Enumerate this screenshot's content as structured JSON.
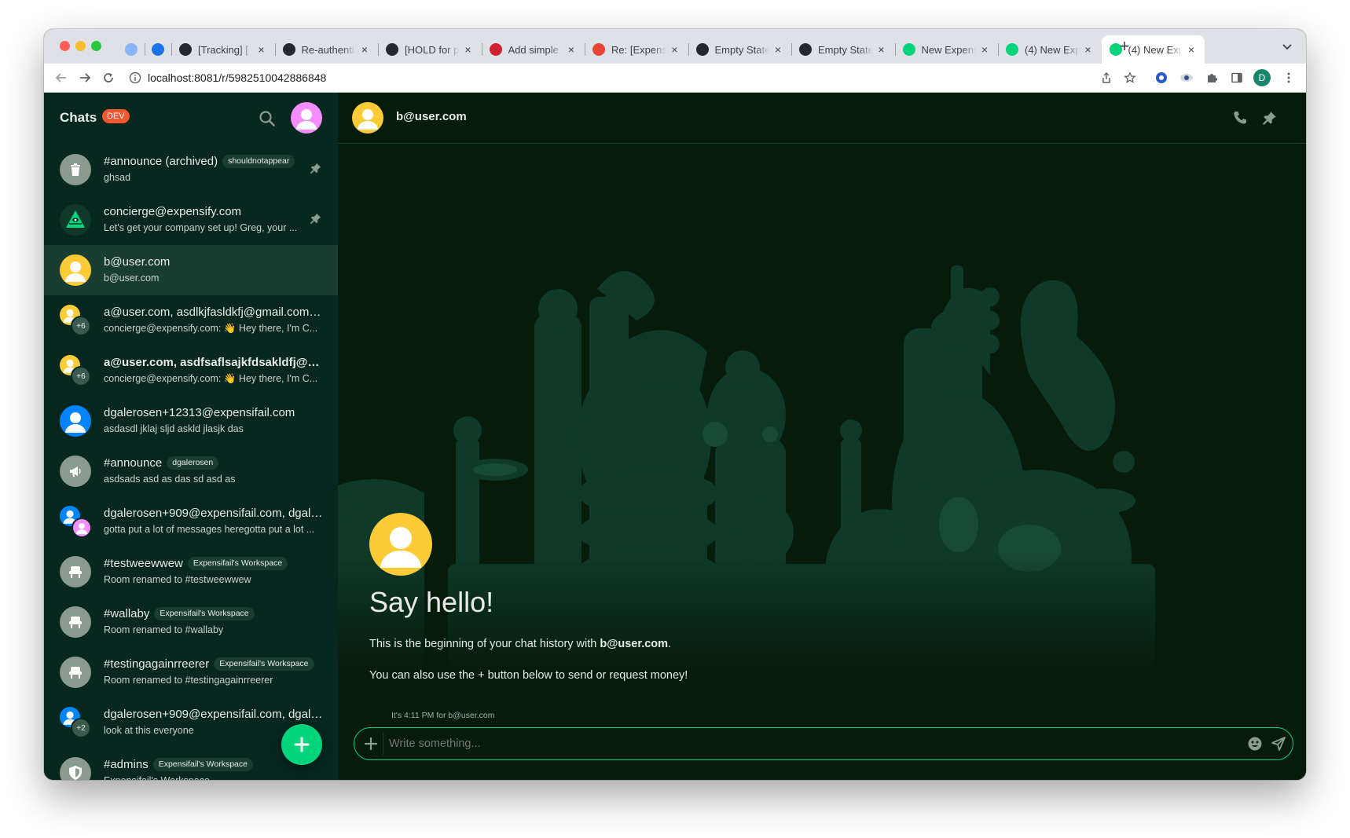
{
  "browser": {
    "tabs": [
      {
        "label": "",
        "icon": "chrome-icon",
        "color": "#8ab4f8"
      },
      {
        "label": "",
        "icon": "calendar-icon",
        "color": "#1a73e8"
      },
      {
        "label": "[Tracking] [",
        "icon": "github-icon",
        "color": "#24292f"
      },
      {
        "label": "Re-authenti",
        "icon": "github-icon",
        "color": "#24292f"
      },
      {
        "label": "[HOLD for p",
        "icon": "github-icon",
        "color": "#24292f"
      },
      {
        "label": "Add simple",
        "icon": "github-pr-icon",
        "color": "#cf222e"
      },
      {
        "label": "Re: [Expens",
        "icon": "gmail-icon",
        "color": "#ea4335"
      },
      {
        "label": "Empty State",
        "icon": "github-icon",
        "color": "#24292f"
      },
      {
        "label": "Empty State",
        "icon": "github-icon",
        "color": "#24292f"
      },
      {
        "label": "New Expens",
        "icon": "expensify-icon",
        "color": "#03d47c"
      },
      {
        "label": "(4) New Exp",
        "icon": "expensify-icon",
        "color": "#03d47c"
      },
      {
        "label": "(4) New Exp",
        "icon": "expensify-icon",
        "color": "#03d47c"
      }
    ],
    "new_tab": "+",
    "url": "localhost:8081/r/5982510042886848",
    "profile_initial": "D"
  },
  "sidebar": {
    "title": "Chats",
    "badge": "DEV",
    "items": [
      {
        "name": "#announce (archived)",
        "pill": "shouldnotappear",
        "preview": "ghsad",
        "avatar": "trash",
        "pinned": true,
        "bold": false,
        "selected": false
      },
      {
        "name": "concierge@expensify.com",
        "pill": "",
        "preview": "Let's get your company set up! Greg, your ...",
        "avatar": "concierge",
        "pinned": true,
        "bold": false,
        "selected": false
      },
      {
        "name": "b@user.com",
        "pill": "",
        "preview": "b@user.com",
        "avatar": "user-yellow",
        "pinned": false,
        "bold": false,
        "selected": true
      },
      {
        "name": "a@user.com, asdlkjfasldkfj@gmail.com, ...",
        "pill": "",
        "preview": "concierge@expensify.com: 👋 Hey there, I'm C...",
        "avatar": "multi",
        "count": "+6",
        "pinned": false,
        "bold": false,
        "selected": false
      },
      {
        "name": "a@user.com, asdfsaflsajkfdsakldfj@gm...",
        "pill": "",
        "preview": "concierge@expensify.com: 👋 Hey there, I'm C...",
        "avatar": "multi",
        "count": "+6",
        "pinned": false,
        "bold": true,
        "selected": false
      },
      {
        "name": "dgalerosen+12313@expensifail.com",
        "pill": "",
        "preview": "asdasdl jklaj sljd askld jlasjk das",
        "avatar": "user-blue",
        "pinned": false,
        "bold": false,
        "selected": false
      },
      {
        "name": "#announce",
        "pill": "dgalerosen",
        "preview": "asdsads asd as das sd asd as",
        "avatar": "megaphone",
        "pinned": false,
        "bold": false,
        "selected": false
      },
      {
        "name": "dgalerosen+909@expensifail.com, dgale...",
        "pill": "",
        "preview": "gotta put a lot of messages heregotta put a lot ...",
        "avatar": "pair",
        "pinned": false,
        "bold": false,
        "selected": false
      },
      {
        "name": "#testweewwew",
        "pill": "Expensifail's Workspace",
        "preview": "Room renamed to #testweewwew",
        "avatar": "chair",
        "pinned": false,
        "bold": false,
        "selected": false
      },
      {
        "name": "#wallaby",
        "pill": "Expensifail's Workspace",
        "preview": "Room renamed to #wallaby",
        "avatar": "chair",
        "pinned": false,
        "bold": false,
        "selected": false
      },
      {
        "name": "#testingagainrreerer",
        "pill": "Expensifail's Workspace",
        "preview": "Room renamed to #testingagainrreerer",
        "avatar": "chair",
        "pinned": false,
        "bold": false,
        "selected": false
      },
      {
        "name": "dgalerosen+909@expensifail.com, dgale...",
        "pill": "",
        "preview": "look at this everyone",
        "avatar": "multi-blue",
        "count": "+2",
        "pinned": false,
        "bold": false,
        "selected": false
      },
      {
        "name": "#admins",
        "pill": "Expensifail's Workspace",
        "preview": "Expensifail's Workspace",
        "avatar": "shield",
        "pinned": false,
        "bold": false,
        "selected": false
      }
    ]
  },
  "chat": {
    "header_name": "b@user.com",
    "welcome_title": "Say hello!",
    "intro_prefix": "This is the beginning of your chat history with ",
    "intro_name": "b@user.com",
    "intro_suffix": ".",
    "money_hint": "You can also use the + button below to send or request money!",
    "timestamp_note": "It's 4:11 PM for b@user.com",
    "composer_placeholder": "Write something..."
  },
  "colors": {
    "accent": "#03d47c",
    "sidebar_bg": "#07271f",
    "main_bg": "#061b09",
    "dev_badge": "#f25730",
    "avatar_yellow": "#fccb38",
    "avatar_blue": "#0185ff",
    "avatar_pink": "#f68dfe",
    "avatar_gray": "#8b9c8f"
  }
}
